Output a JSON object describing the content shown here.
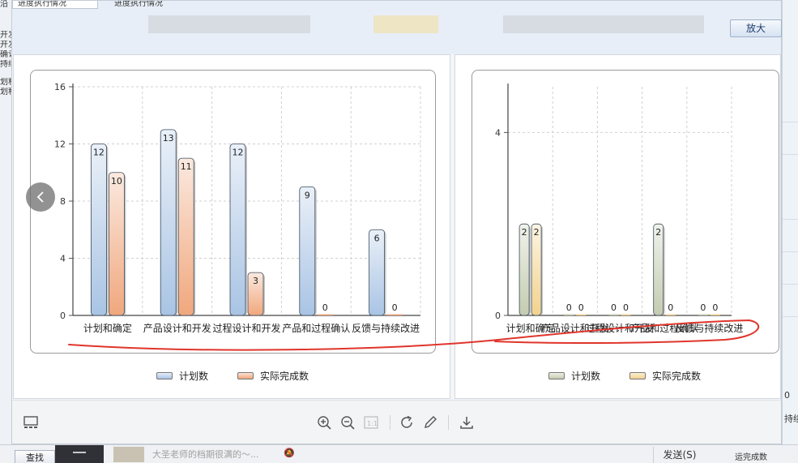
{
  "viewer": {
    "tabs": [
      "进度执行情况",
      "进度执行情况"
    ],
    "zoom_button": "放大"
  },
  "legend_left": {
    "planned": "计划数",
    "actual": "实际完成数",
    "planned_color": "#a9c4e4",
    "actual_color": "#f0a77d"
  },
  "legend_right": {
    "planned": "计划数",
    "actual": "实际完成数",
    "planned_color": "#c4cbb0",
    "actual_color": "#f2d28e"
  },
  "chart_data": [
    {
      "type": "bar",
      "categories": [
        "计划和确定",
        "产品设计和开发",
        "过程设计和开发",
        "产品和过程确认",
        "反馈与持续改进"
      ],
      "series": [
        {
          "name": "计划数",
          "values": [
            12,
            13,
            12,
            9,
            6
          ],
          "color": "#a9c4e4"
        },
        {
          "name": "实际完成数",
          "values": [
            10,
            11,
            3,
            0,
            0
          ],
          "color": "#f0a77d"
        }
      ],
      "ylim": [
        0,
        16
      ],
      "yticks": [
        0,
        4,
        8,
        12,
        16
      ],
      "grid": true,
      "legend": "bottom"
    },
    {
      "type": "bar",
      "categories": [
        "计划和确定",
        "产品设计和开发",
        "过程设计和开发",
        "产品和过程确认",
        "反馈与持续改进"
      ],
      "series": [
        {
          "name": "计划数",
          "values": [
            2,
            0,
            0,
            2,
            0
          ],
          "color": "#c4cbb0"
        },
        {
          "name": "实际完成数",
          "values": [
            2,
            0,
            0,
            0,
            0
          ],
          "color": "#f2d28e"
        }
      ],
      "ylim": [
        0,
        5
      ],
      "yticks": [
        0,
        4
      ],
      "grid": true,
      "legend": "bottom"
    }
  ],
  "background": {
    "left_labels": [
      "沿",
      "开发",
      "开发",
      "确认",
      "持续",
      "划程",
      "划程"
    ],
    "right_labels": [
      "0",
      "持续"
    ],
    "bottom_bar": {
      "find_button": "查找",
      "chat_preview": "大圣老师的档期很满的～...",
      "send_button": "发送(S)",
      "right_text": "运完成数"
    }
  }
}
